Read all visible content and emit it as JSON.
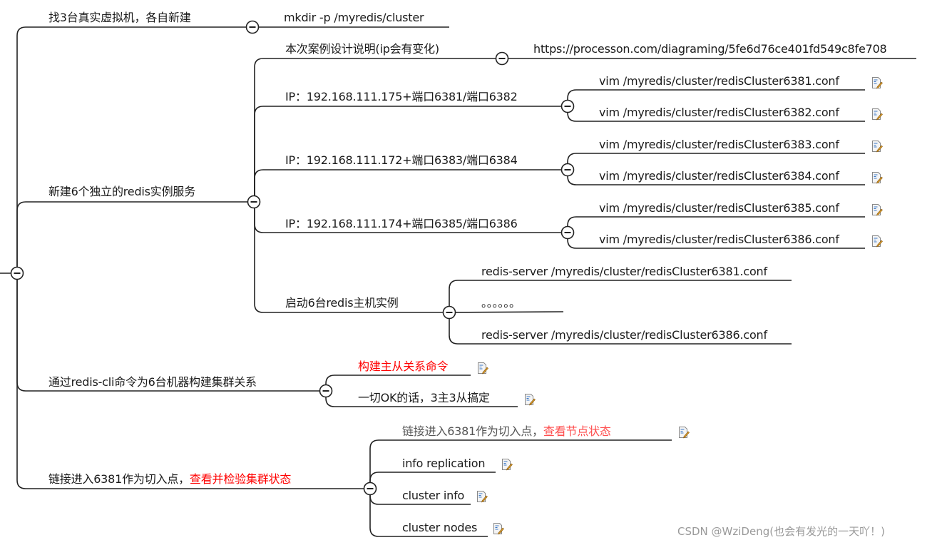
{
  "mindmap": {
    "n1": {
      "label": "找3台真实虚拟机，各自新建",
      "child": "mkdir -p /myredis/cluster"
    },
    "n2": {
      "label": "新建6个独立的redis实例服务",
      "design": {
        "label": "本次案例设计说明(ip会有变化)",
        "child": "https://processon.com/diagraming/5fe6d76ce401fd549c8fe708"
      },
      "ip1": {
        "label": "IP：192.168.111.175+端口6381/端口6382",
        "children": [
          "vim  /myredis/cluster/redisCluster6381.conf",
          "vim  /myredis/cluster/redisCluster6382.conf"
        ]
      },
      "ip2": {
        "label": "IP：192.168.111.172+端口6383/端口6384",
        "children": [
          "vim  /myredis/cluster/redisCluster6383.conf",
          "vim  /myredis/cluster/redisCluster6384.conf"
        ]
      },
      "ip3": {
        "label": "IP：192.168.111.174+端口6385/端口6386",
        "children": [
          "vim  /myredis/cluster/redisCluster6385.conf",
          "vim  /myredis/cluster/redisCluster6386.conf"
        ]
      },
      "start": {
        "label": "启动6台redis主机实例",
        "children": [
          "redis-server /myredis/cluster/redisCluster6381.conf",
          "。。。。。。",
          "redis-server /myredis/cluster/redisCluster6386.conf"
        ]
      }
    },
    "n3": {
      "label": "通过redis-cli命令为6台机器构建集群关系",
      "children": [
        "构建主从关系命令",
        "一切OK的话，3主3从搞定"
      ]
    },
    "n4": {
      "label_a": "链接进入6381作为切入点，",
      "label_b": "查看并检验集群状态",
      "c1_a": "链接进入6381作为切入点，",
      "c1_b": "查看节点状态",
      "children": [
        "info replication",
        "cluster info",
        "cluster nodes"
      ]
    }
  },
  "icons": {
    "collapse": "minus-circle-icon",
    "note": "note-icon"
  },
  "colors": {
    "line": "#222222",
    "highlight": "#ff0000",
    "highlight_soft": "#ff4d4d"
  },
  "watermark": "CSDN @WziDeng(也会有发光的一天吖！)"
}
